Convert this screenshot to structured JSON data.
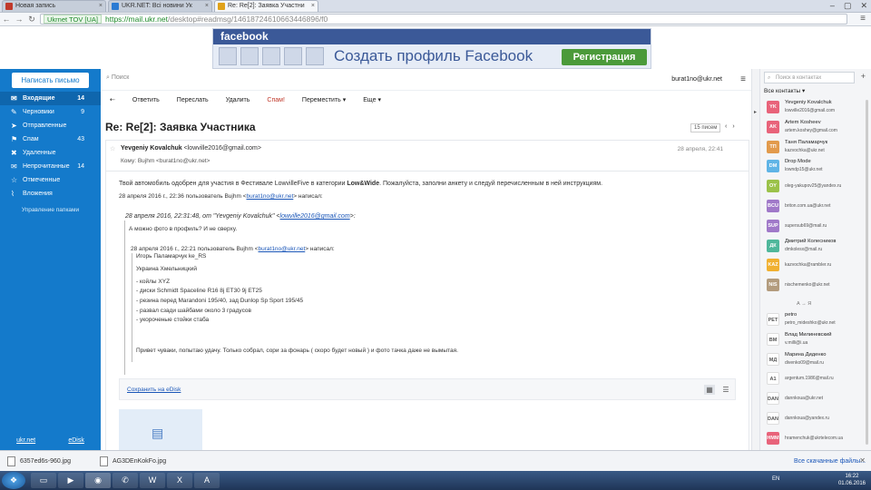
{
  "browser": {
    "tabs": [
      {
        "title": "Новая запись",
        "favicon_color": "#c0392b"
      },
      {
        "title": "UKR.NET: Всі новини Ук",
        "favicon_color": "#2b7bd3"
      },
      {
        "title": "Re: Re[2]: Заявка Участни",
        "favicon_color": "#e0a21a",
        "active": true
      }
    ],
    "secure_label": "Ukrnet TOV [UA]",
    "url_scheme_host": "https://mail.ukr.net",
    "url_path": "/desktop#readmsg/14618724610663446896/f0"
  },
  "ad": {
    "brand": "facebook",
    "headline": "Создать профиль Facebook",
    "button": "Регистрация"
  },
  "sidebar": {
    "compose": "Написать письмо",
    "folders": [
      {
        "label": "Входящие",
        "count": "14",
        "icon": "inbox-icon",
        "glyph": "✉",
        "active": true
      },
      {
        "label": "Черновики",
        "count": "9",
        "icon": "pencil-icon",
        "glyph": "✎"
      },
      {
        "label": "Отправленные",
        "count": "",
        "icon": "send-icon",
        "glyph": "➤"
      },
      {
        "label": "Спам",
        "count": "43",
        "icon": "spam-icon",
        "glyph": "⚑"
      },
      {
        "label": "Удаленные",
        "count": "",
        "icon": "trash-icon",
        "glyph": "🗑"
      },
      {
        "label": "Непрочитанные",
        "count": "14",
        "icon": "unread-icon",
        "glyph": "✉"
      },
      {
        "label": "Отмеченные",
        "count": "",
        "icon": "star-icon",
        "glyph": "☆"
      },
      {
        "label": "Вложения",
        "count": "",
        "icon": "attachment-icon",
        "glyph": "📎"
      }
    ],
    "manage": "Управление папками",
    "footer_left": "ukr.net",
    "footer_right": "eDisk"
  },
  "topbar": {
    "search_placeholder": "Поиск",
    "user": "burat1no@ukr.net"
  },
  "toolbar": {
    "reply": "Ответить",
    "forward": "Переслать",
    "delete": "Удалить",
    "spam": "Спам!",
    "move": "Переместить ▾",
    "more": "Еще ▾"
  },
  "message": {
    "subject": "Re: Re[2]: Заявка Участника",
    "count": "15 писем",
    "from_name": "Yevgeniy Kovalchuk",
    "from_email": "<lowville2016@gmail.com>",
    "to_label": "Кому:",
    "to": "Bujhm <burat1no@ukr.net>",
    "date": "28 апреля, 22:41",
    "body_line1": "Твой автомобиль одобрен для участия в Фестивале LowvilleFive в категории",
    "body_cat": "Low&Wide",
    "body_line1b": ". Пожалуйста, заполни анкету и следуй перечисленным в ней инструкциям.",
    "quote_head_pre": "28 апреля 2016 г., 22:36 пользователь Bujhm <",
    "quote_head_link": "burat1no@ukr.net",
    "quote_head_post": "> написал:",
    "q1_head_pre": "28 апреля 2016, 22:31:48, от \"Yevgeniy Kovalchuk\" <",
    "q1_head_link": "lowville2016@gmail.com",
    "q1_head_post": ">:",
    "q1_text": "А можно фото в профиль? И не сверху.",
    "q2_head_pre": "28 апреля 2016 г., 22:21 пользователь Bujhm <",
    "q2_head_link": "burat1no@ukr.net",
    "q2_head_post": "> написал:",
    "q2_lines": [
      "Игорь Паламарчук ke_RS",
      "Украина Хмельницкий",
      "- койлы XYZ",
      "- диски  Schmidt Spaceline R16 8j ET30 9j ET25",
      "- резина перед Marandoni 195/40, зад Dunlop Sp Sport 195/45",
      "- развал сзади шайбами около 3 градусов",
      "- укороченые стойки стаба",
      "Привет чуваки, попытаю удачу. Только собрал, сори за фонарь ( скоро будет новый ) и фото тачка даже не вымытая."
    ],
    "save_edisk": "Сохранить на eDisk"
  },
  "contacts": {
    "search_placeholder": "Поиск в контактах",
    "all_label": "Все контакты ▾",
    "list": [
      {
        "initials": "YK",
        "color": "#e8637a",
        "name": "Yevgeniy Kovalchuk",
        "email": "lowville2016@gmail.com"
      },
      {
        "initials": "AK",
        "color": "#e8637a",
        "name": "Artem Kosheev",
        "email": "artem.koshey@gmail.com"
      },
      {
        "initials": "ТП",
        "color": "#e29a4c",
        "name": "Таня Паламарчук",
        "email": "kazvochka@ukr.net"
      },
      {
        "initials": "DM",
        "color": "#5fb4e6",
        "name": "Drop Mode",
        "email": "lowndp15@ukr.net"
      },
      {
        "initials": "OY",
        "color": "#9bc24a",
        "name": "",
        "email": "oleg-yakupov25@yandex.ru"
      },
      {
        "initials": "BCU",
        "color": "#a079c9",
        "name": "",
        "email": "briton.com.ua@ukr.net"
      },
      {
        "initials": "SUP",
        "color": "#a079c9",
        "name": "",
        "email": "supersub69@mail.ru"
      },
      {
        "initials": "ДК",
        "color": "#4fb79b",
        "name": "Дмитрий Колесников",
        "email": "dmkolesx@mail.ru"
      },
      {
        "initials": "KAZ",
        "color": "#f0b030",
        "name": "",
        "email": "kazvochka@rambler.ru"
      },
      {
        "initials": "NIS",
        "color": "#b39c7e",
        "name": "",
        "email": "nischemenko@ukr.net"
      }
    ],
    "separator": "А → Я",
    "list2": [
      {
        "initials": "PET",
        "name": "petro",
        "email": "petro_mideshko@ukr.net"
      },
      {
        "initials": "ВМ",
        "name": "Влад Милиневский",
        "email": "v.milli@i.ua"
      },
      {
        "initials": "МД",
        "name": "Марина Диденко",
        "email": "divenko09@mail.ru"
      },
      {
        "initials": "A1",
        "name": "",
        "email": "argentum.1986@mail.ru"
      },
      {
        "initials": "DAN",
        "name": "",
        "email": "dannkoua@ukr.net"
      },
      {
        "initials": "DAN",
        "name": "",
        "email": "dannkoua@yandex.ru"
      },
      {
        "initials": "HMM",
        "name": "",
        "email": "hramenchuk@ukrtelecom.ua",
        "color": "#e8637a"
      }
    ]
  },
  "downloads": {
    "items": [
      "6357ed6s-960.jpg",
      "AG3DEnKokFo.jpg"
    ],
    "show_all": "Все скачанные файлы..."
  },
  "taskbar": {
    "lang": "EN",
    "time": "16:22",
    "date": "01.06.2016"
  }
}
